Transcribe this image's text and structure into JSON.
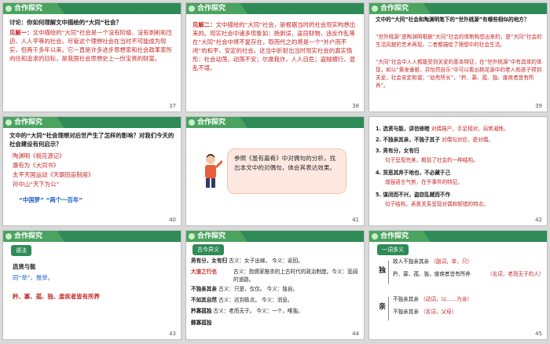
{
  "slides": [
    {
      "header": "合作探究",
      "page": "37",
      "title": "讨论：你如何理解文中描绘的“大同”社会？",
      "answer_label": "见解一：",
      "answer_text": "文中描绘的“大同”社会是一个没有阶级、没有剥削和压迫、人人平等的社会。尽管这个理想社会在当时不可能成为现实，但两千多年以来，它一直是许多进步思想家和社会政革家所向往和追求的目标，是我国社会思想史上一份宝贵的财富。"
    },
    {
      "header": "合作探究",
      "page": "38",
      "answer_label": "见解二：",
      "answer_text": "文中描绘的“大同”社会，是根据当时的社会现实构想出来的。现实社会中诸多现象如：扬剥误，盗窃财物，违反作乱等在“大同”社会中将不复存在，取而代之的将是一个“外户而不闭”的和平、安定的社会。这当中折射出当时现实社会的真实情形：社会动荡，动荡不安；尔虞我诈，人人自危；盗贼横行，混乱不堪。"
    },
    {
      "header": "合作探究",
      "page": "39",
      "title": "文中的“大同”社会和陶渊明笔下的“世外桃源”有哪些相似的地方？",
      "p1": "“世外桃源”是陶渊明根据“大同”社会的体制构想出来的，是“大同”社会的生活风貌的艺术再现。二者都描绘了理想中的社会生活。",
      "p2": "“大同”社会中人人都能受到关爱的基本特征，在“世外桃源”中有具体的体现，如以“黄发垂髫，并怡然自乐”中可以看出桃花源中的老人和孩子得到关爱，社会安定和谐；“幼有所长”，“矜、寡、孤、独、废疾者皆有所养”。"
    },
    {
      "header": "合作探究",
      "page": "40",
      "title": "文中的“大同”社会理想对后世产生了怎样的影响？对我们今天的社会建设有何启示？",
      "items": [
        "陶渊明《桃花源记》",
        "康有为《大同书》",
        "太平天国运动《天朝田亩制度》",
        "孙中山“天下为公”"
      ],
      "footer": "“中国梦”  “两个一百年”"
    },
    {
      "header": "合作探究",
      "page": "41",
      "callout": "参照《虽有嘉肴》中对偶句的分析，找出本文中的对偶句，体会其表达效果。"
    },
    {
      "header": "",
      "page": "42",
      "lines": [
        {
          "pre": "1. 选贤与能，讲信修睦",
          "red": "对偶描户，手足相对，局势凝炼。"
        },
        {
          "pre": "2. 不独亲其亲，不独子其子",
          "red": "对偶句对应，是对偶。"
        },
        {
          "pre": "3. 男有分，女有归",
          "red": "句子呈现完美，概括了社会的一种结构。"
        },
        {
          "pre": "4. 货恶其弃于地也，不必藏于己",
          "red": "增强语言气势，在乎事件的特征。"
        },
        {
          "pre": "5. 谋闭而不兴，盗窃乱贼而不作",
          "red": "句子结构，表意关系呈现对偶和顿错的特点。"
        }
      ]
    },
    {
      "header": "合作探究",
      "page": "43",
      "tab": "语法",
      "l1": "选贤与能",
      "l2": "同“举”，推举。",
      "l3": "矜、寡、孤、独、废疾者皆有所养"
    },
    {
      "header": "合作探究",
      "page": "44",
      "tab": "古今异义",
      "rows": [
        {
          "word": "男有分，女有归",
          "note": "古义：女子出嫁。  今义：返回。"
        },
        {
          "word": "大道之行也",
          "note": "古义：指儒家推崇的上古时代的政治制度。今义：宽阔的道路。"
        },
        {
          "word": "不独亲其亲",
          "note": "古义：只是，仅仅。  今义：独自。"
        },
        {
          "word": "不如其自然",
          "note": "古义：达到极点。  今义：消息。"
        },
        {
          "word": "矜寡孤独",
          "note": "古义：老而无子。  今义：一个，唯独。"
        },
        {
          "word": "鳏寡孤独",
          "note": ""
        }
      ]
    },
    {
      "header": "合作探究",
      "page": "45",
      "tab": "一词多义",
      "g1_char": "独",
      "g1_a": "故人不独亲其亲",
      "g1_a_note": "（副词，单，只）",
      "g1_b": "矜、寡、孤、独，废疾者皆有所养",
      "g1_b_note": "（名词，老而无子的人）",
      "g2_char": "亲",
      "g2_a": "不独亲其亲",
      "g2_a_note": "（动词，以……为亲）",
      "g2_b": "不独亲其亲",
      "g2_b_note": "（名词，父母）"
    }
  ]
}
